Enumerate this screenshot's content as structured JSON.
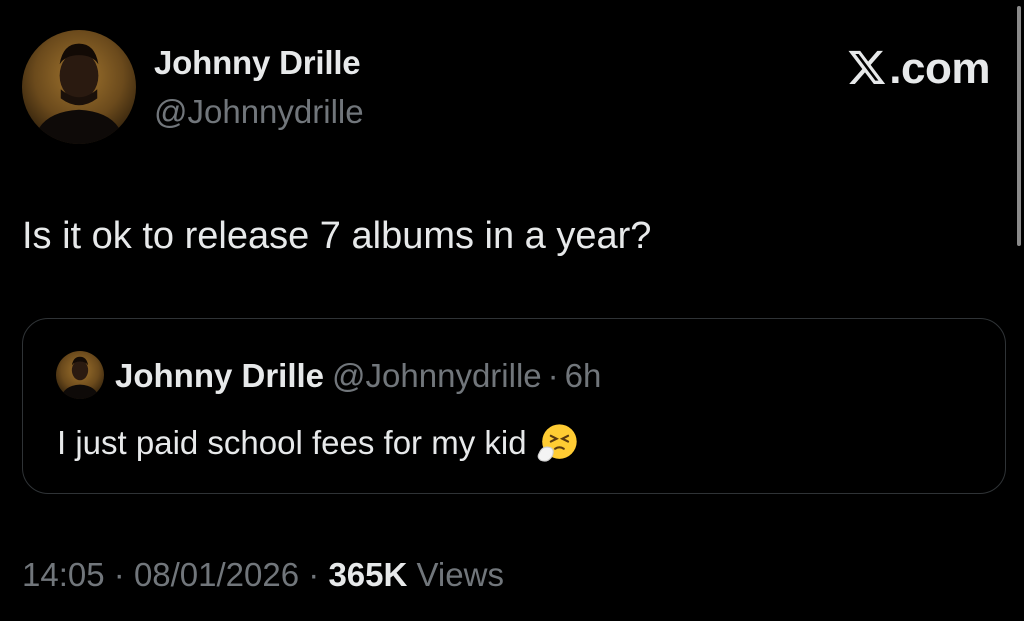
{
  "author": {
    "display_name": "Johnny Drille",
    "handle": "@Johnnydrille"
  },
  "brand": {
    "label": ".com",
    "icon": "x-logo-icon"
  },
  "tweet": {
    "text": "Is it ok to release 7 albums in a year?"
  },
  "quote": {
    "display_name": "Johnny Drille",
    "handle": "@Johnnydrille",
    "separator": "·",
    "time": "6h",
    "text": "I just paid school fees for my kid",
    "emoji": "sneezing-face-emoji"
  },
  "footer": {
    "time": "14:05",
    "sep1": "·",
    "date": "08/01/2026",
    "sep2": "·",
    "views_count": "365K",
    "views_label": "Views"
  },
  "colors": {
    "background": "#000000",
    "primary_text": "#e7e9ea",
    "secondary_text": "#71767b",
    "border": "#2f3336"
  }
}
